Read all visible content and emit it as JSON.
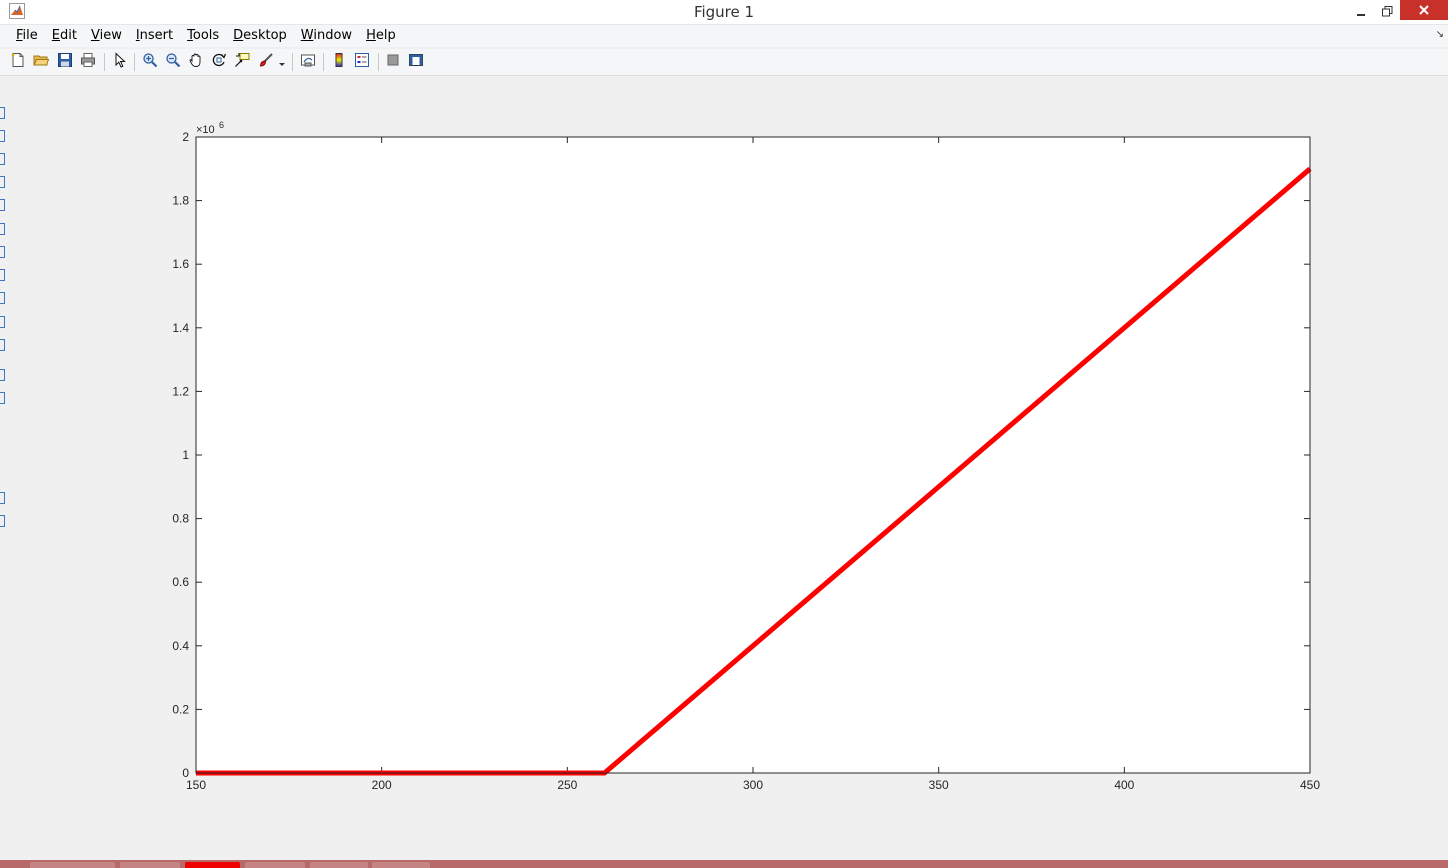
{
  "window": {
    "title": "Figure 1"
  },
  "menu": {
    "items": [
      {
        "label": "File",
        "accel": "F",
        "rest": "ile"
      },
      {
        "label": "Edit",
        "accel": "E",
        "rest": "dit"
      },
      {
        "label": "View",
        "accel": "V",
        "rest": "iew"
      },
      {
        "label": "Insert",
        "accel": "I",
        "rest": "nsert"
      },
      {
        "label": "Tools",
        "accel": "T",
        "rest": "ools"
      },
      {
        "label": "Desktop",
        "accel": "D",
        "rest": "esktop"
      },
      {
        "label": "Window",
        "accel": "W",
        "rest": "indow"
      },
      {
        "label": "Help",
        "accel": "H",
        "rest": "elp"
      }
    ]
  },
  "toolbar": {
    "buttons": [
      {
        "name": "new-figure-button",
        "icon": "new-file-icon"
      },
      {
        "name": "open-file-button",
        "icon": "folder-open-icon"
      },
      {
        "name": "save-figure-button",
        "icon": "save-icon"
      },
      {
        "name": "print-figure-button",
        "icon": "print-icon"
      },
      {
        "name": "edit-plot-button",
        "icon": "pointer-arrow-icon"
      },
      {
        "name": "zoom-in-button",
        "icon": "zoom-in-icon"
      },
      {
        "name": "zoom-out-button",
        "icon": "zoom-out-icon"
      },
      {
        "name": "pan-button",
        "icon": "hand-icon"
      },
      {
        "name": "rotate-3d-button",
        "icon": "rotate-icon"
      },
      {
        "name": "data-cursor-button",
        "icon": "data-cursor-icon"
      },
      {
        "name": "brush-button",
        "icon": "brush-icon"
      },
      {
        "name": "link-plot-button",
        "icon": "link-plot-icon"
      },
      {
        "name": "insert-colorbar-button",
        "icon": "colorbar-icon"
      },
      {
        "name": "insert-legend-button",
        "icon": "legend-icon"
      },
      {
        "name": "hide-plot-tools-button",
        "icon": "hide-tools-icon"
      },
      {
        "name": "show-plot-tools-button",
        "icon": "show-tools-icon"
      }
    ]
  },
  "colors": {
    "line": "#ff0000",
    "axes_bg": "#ffffff",
    "figure_bg": "#f0f0f0",
    "axis": "#262626"
  },
  "chart_data": {
    "type": "line",
    "title": "",
    "xlabel": "",
    "ylabel": "",
    "xlim": [
      150,
      450
    ],
    "ylim": [
      0,
      2000000
    ],
    "y_exponent_label": "×10",
    "y_exponent": "6",
    "grid": false,
    "xticks": [
      150,
      200,
      250,
      300,
      350,
      400,
      450
    ],
    "xtick_labels": [
      "150",
      "200",
      "250",
      "300",
      "350",
      "400",
      "450"
    ],
    "yticks": [
      0,
      200000,
      400000,
      600000,
      800000,
      1000000,
      1200000,
      1400000,
      1600000,
      1800000,
      2000000
    ],
    "ytick_labels": [
      "0",
      "0.2",
      "0.4",
      "0.6",
      "0.8",
      "1",
      "1.2",
      "1.4",
      "1.6",
      "1.8",
      "2"
    ],
    "series": [
      {
        "x": [
          150,
          260,
          450
        ],
        "y": [
          0,
          0,
          1900000
        ],
        "color": "#ff0000"
      }
    ]
  }
}
